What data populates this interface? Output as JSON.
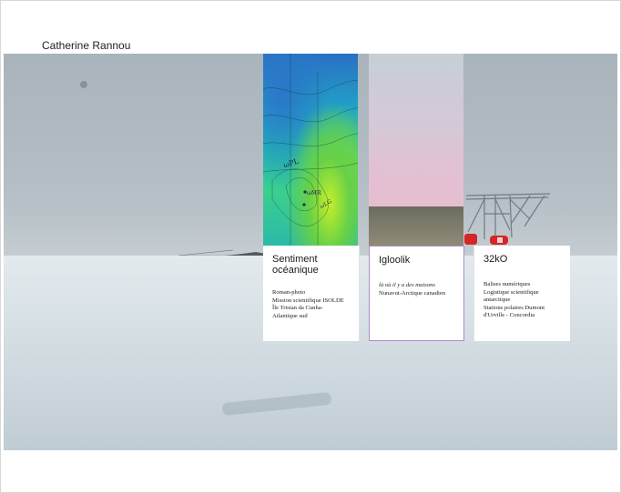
{
  "site": {
    "title": "Catherine Rannou"
  },
  "projects": [
    {
      "title": "Sentiment océanique",
      "lines": [
        {
          "text": "Roman-photo",
          "italic": false
        },
        {
          "text": "Mission scientifique ISOLDE",
          "italic": false
        },
        {
          "text": "Île Tristan da Cunha-",
          "italic": false
        },
        {
          "text": "Atlantique sud",
          "italic": false
        }
      ]
    },
    {
      "title": "Igloolik",
      "lines": [
        {
          "text": "là où il y a des maisons",
          "italic": true
        },
        {
          "text": "Nunavut-Arctique canadien",
          "italic": false
        }
      ]
    },
    {
      "title": "32kO",
      "lines": [
        {
          "text": "Balises numériques",
          "italic": false
        },
        {
          "text": "Logistique scientifique",
          "italic": false
        },
        {
          "text": "antarctique",
          "italic": false
        },
        {
          "text": "Stations polaires Dumont",
          "italic": false
        },
        {
          "text": "d'Urville - Concordia",
          "italic": false
        }
      ]
    }
  ],
  "map_labels": [
    "ωPL",
    "ωMR",
    "ωLG"
  ],
  "colors": {
    "hover_border": "#b08ac8",
    "sky": "#aeb9c0",
    "snow": "#d9e2e6"
  }
}
